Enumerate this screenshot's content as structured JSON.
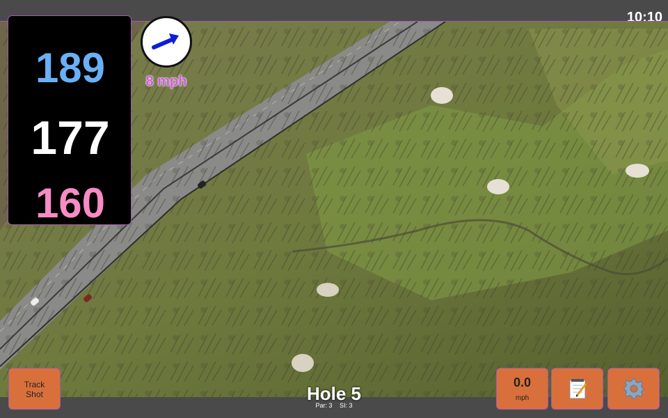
{
  "status_bar": {
    "time": "10:10"
  },
  "distances": {
    "back": "189",
    "middle": "177",
    "front": "160"
  },
  "wind": {
    "icon": "wind-arrow-icon",
    "speed_label": "8 mph"
  },
  "buttons": {
    "track_shot_line1": "Track",
    "track_shot_line2": "Shot",
    "speed_value": "0.0",
    "speed_unit": "mph",
    "notes_icon": "notepad-icon",
    "settings_icon": "gear-icon"
  },
  "hole": {
    "title": "Hole 5",
    "par": "Par: 3",
    "si": "SI: 3"
  },
  "colors": {
    "back_distance": "#6ab0f5",
    "middle_distance": "#ffffff",
    "front_distance": "#f78bc4",
    "wind_label": "#d05ce0",
    "button_bg": "#d9703b",
    "accent_border": "#a25ab0"
  }
}
